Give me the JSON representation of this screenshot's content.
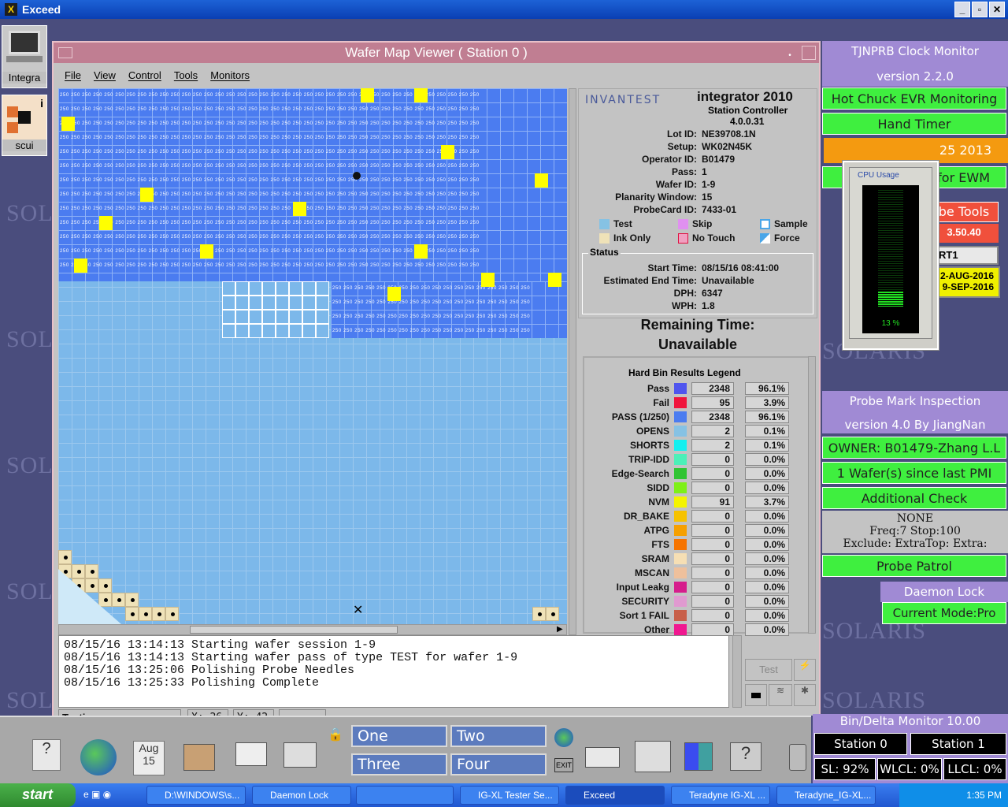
{
  "exceed": {
    "title": "Exceed",
    "buttons": [
      "_",
      "▫",
      "✕"
    ]
  },
  "desktop_icons": [
    {
      "label": "Integra"
    },
    {
      "label": "scui"
    }
  ],
  "wafer_window": {
    "title": "Wafer Map Viewer ( Station 0 )",
    "menu": [
      "File",
      "View",
      "Control",
      "Tools",
      "Monitors"
    ],
    "die_label": "250",
    "info": {
      "brand": "INVANTEST",
      "product": "integrator 2010",
      "subtitle": "Station Controller",
      "version": "4.0.0.31",
      "fields": [
        {
          "label": "Lot ID:",
          "value": "NE39708.1N"
        },
        {
          "label": "Setup:",
          "value": "WK02N45K"
        },
        {
          "label": "Operator ID:",
          "value": "B01479"
        },
        {
          "label": "Pass:",
          "value": "1"
        },
        {
          "label": "Wafer ID:",
          "value": "1-9"
        },
        {
          "label": "Planarity Window:",
          "value": "15"
        },
        {
          "label": "ProbeCard ID:",
          "value": "7433-01"
        }
      ],
      "legend": [
        "Test",
        "Skip",
        "Sample",
        "Ink Only",
        "No Touch",
        "Force"
      ],
      "status_label": "Status",
      "status": [
        {
          "label": "Start Time:",
          "value": "08/15/16 08:41:00"
        },
        {
          "label": "Estimated End Time:",
          "value": "Unavailable"
        },
        {
          "label": "DPH:",
          "value": "6347"
        },
        {
          "label": "WPH:",
          "value": "1.8"
        }
      ]
    },
    "remaining": {
      "label": "Remaining Time:",
      "value": "Unavailable"
    },
    "bins": {
      "title": "Hard Bin Results Legend",
      "rows": [
        {
          "name": "Pass",
          "color": "#4f55ee",
          "count": "2348",
          "pct": "96.1%"
        },
        {
          "name": "Fail",
          "color": "#f0153c",
          "count": "95",
          "pct": "3.9%"
        },
        {
          "name": "PASS (1/250)",
          "color": "#4b7cf0",
          "count": "2348",
          "pct": "96.1%"
        },
        {
          "name": "OPENS",
          "color": "#86c2e4",
          "count": "2",
          "pct": "0.1%"
        },
        {
          "name": "SHORTS",
          "color": "#14f0f0",
          "count": "2",
          "pct": "0.1%"
        },
        {
          "name": "TRIP-IDD",
          "color": "#4cf0b8",
          "count": "0",
          "pct": "0.0%"
        },
        {
          "name": "Edge-Search",
          "color": "#2fc432",
          "count": "0",
          "pct": "0.0%"
        },
        {
          "name": "SIDD",
          "color": "#7ef018",
          "count": "0",
          "pct": "0.0%"
        },
        {
          "name": "NVM",
          "color": "#f4f400",
          "count": "91",
          "pct": "3.7%"
        },
        {
          "name": "DR_BAKE",
          "color": "#f6c200",
          "count": "0",
          "pct": "0.0%"
        },
        {
          "name": "ATPG",
          "color": "#f6a000",
          "count": "0",
          "pct": "0.0%"
        },
        {
          "name": "FTS",
          "color": "#f67400",
          "count": "0",
          "pct": "0.0%"
        },
        {
          "name": "SRAM",
          "color": "#f6dfb4",
          "count": "0",
          "pct": "0.0%"
        },
        {
          "name": "MSCAN",
          "color": "#eec09c",
          "count": "0",
          "pct": "0.0%"
        },
        {
          "name": "Input Leakg",
          "color": "#d61d8c",
          "count": "0",
          "pct": "0.0%"
        },
        {
          "name": "SECURITY",
          "color": "#e09ad0",
          "count": "0",
          "pct": "0.0%"
        },
        {
          "name": "Sort 1 FAIL",
          "color": "#c8604a",
          "count": "0",
          "pct": "0.0%"
        },
        {
          "name": "Other",
          "color": "#f01890",
          "count": "0",
          "pct": "0.0%"
        }
      ]
    },
    "log": [
      "08/15/16 13:14:13 Starting wafer session 1-9",
      "08/15/16 13:14:13 Starting wafer pass of type TEST for wafer 1-9",
      "08/15/16 13:25:06 Polishing Probe Needles",
      "08/15/16 13:25:33 Polishing Complete"
    ],
    "test_button": "Test",
    "statusbar": {
      "state": "Testing",
      "x": "X: 26",
      "y": "Y: 42"
    }
  },
  "right_panel": {
    "clock_title": "TJNPRB Clock Monitor",
    "clock_version": "version 2.2.0",
    "hot_chuck": "Hot Chuck EVR Monitoring",
    "hand_timer": "Hand Timer",
    "date_partial": "25 2013",
    "for_ewm": "for EWM",
    "probe_tools": "be Tools",
    "ip_partial": "3.50.40",
    "port_partial": "RT1",
    "date1": "2-AUG-2016",
    "date2": "9-SEP-2016",
    "pmi_title": "Probe Mark Inspection",
    "pmi_version": "version 4.0 By JiangNan",
    "owner": "OWNER: B01479-Zhang L.L",
    "wafer_since": "1 Wafer(s) since last PMI",
    "additional": "Additional Check",
    "none": "NONE",
    "freq": "Freq:7 Stop:100",
    "exclude": "Exclude: ExtraTop: Extra:",
    "probe_patrol": "Probe Patrol",
    "daemon_lock": "Daemon Lock",
    "current_mode": "Current Mode:Pro"
  },
  "cpu": {
    "title": "CPU Usage",
    "value": "13 %",
    "level": 0.13
  },
  "dock": {
    "calendar_month": "Aug",
    "calendar_day": "15",
    "workspaces": [
      "One",
      "Two",
      "Three",
      "Four"
    ],
    "exit": "EXIT"
  },
  "bin_delta": {
    "title": "Bin/Delta Monitor 10.00",
    "stations": [
      "Station 0",
      "Station 1"
    ],
    "sl": "SL: 92%",
    "wlcl": "WLCL: 0%",
    "llcl": "LLCL: 0%"
  },
  "taskbar": {
    "start": "start",
    "items": [
      "D:\\WINDOWS\\s...",
      "Daemon Lock",
      "",
      "IG-XL Tester Se...",
      "Exceed",
      "Teradyne IG-XL ...",
      "Teradyne_IG-XL..."
    ],
    "clock": "1:35 PM"
  },
  "desktop_text": "SOLARIS",
  "colors": {
    "tested": "#4b7cf0",
    "untested": "#7cb8ea",
    "nvm": "#ffff00",
    "title": "#c07e92",
    "green": "#3fef3f",
    "purple": "#a08ad4"
  }
}
